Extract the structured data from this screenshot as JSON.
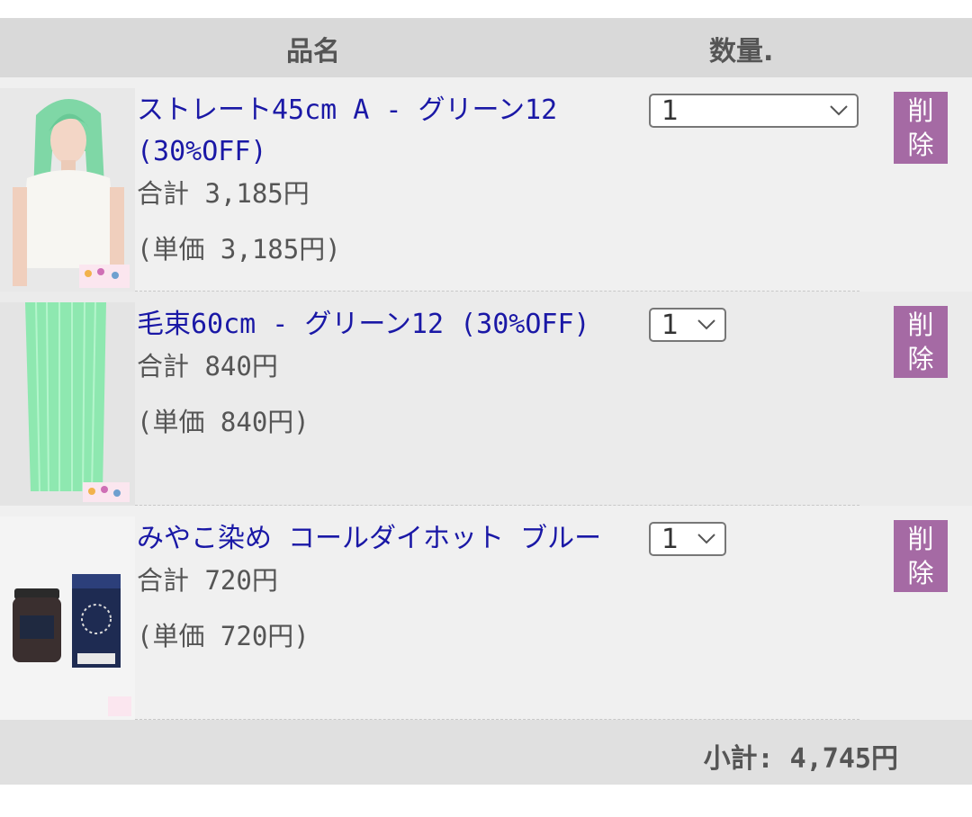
{
  "header": {
    "name": "品名",
    "qty": "数量."
  },
  "items": [
    {
      "title": "ストレート45cm A - グリーン12 (30%OFF)",
      "total": "合計 3,185円",
      "unit": "(単価 3,185円)",
      "qty": "1",
      "delete_top": "削",
      "delete_bottom": "除"
    },
    {
      "title": "毛束60cm - グリーン12 (30%OFF)",
      "total": "合計 840円",
      "unit": "(単価 840円)",
      "qty": "1",
      "delete_top": "削",
      "delete_bottom": "除"
    },
    {
      "title": "みやこ染め コールダイホット ブルー",
      "total": "合計 720円",
      "unit": "(単価 720円)",
      "qty": "1",
      "delete_top": "削",
      "delete_bottom": "除"
    }
  ],
  "footer": {
    "subtotal": "小計: 4,745円"
  },
  "colors": {
    "link": "#1a18a6",
    "delete_bg": "#a56aa4",
    "header_bg": "#d9d9d9"
  },
  "icons": {
    "select_arrow": "chevron-down-icon"
  }
}
